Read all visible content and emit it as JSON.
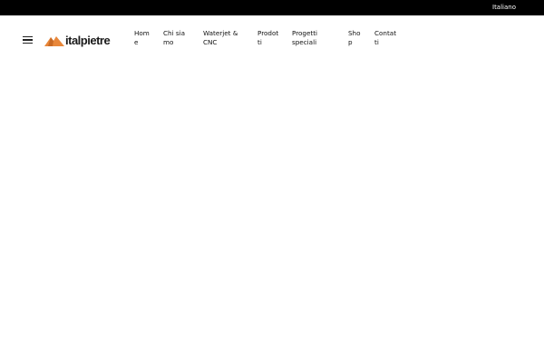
{
  "topbar": {
    "language": "Italiano"
  },
  "header": {
    "logo_text": "italpietre",
    "brand_color": "#e8873a",
    "menu_icon": "hamburger-icon"
  },
  "nav": {
    "items": [
      {
        "label": "Home"
      },
      {
        "label": "Chi siamo"
      },
      {
        "label": "Waterjet & CNC"
      },
      {
        "label": "Prodotti"
      },
      {
        "label": "Progetti speciali"
      },
      {
        "label": "Shop"
      },
      {
        "label": "Contatti"
      }
    ]
  }
}
